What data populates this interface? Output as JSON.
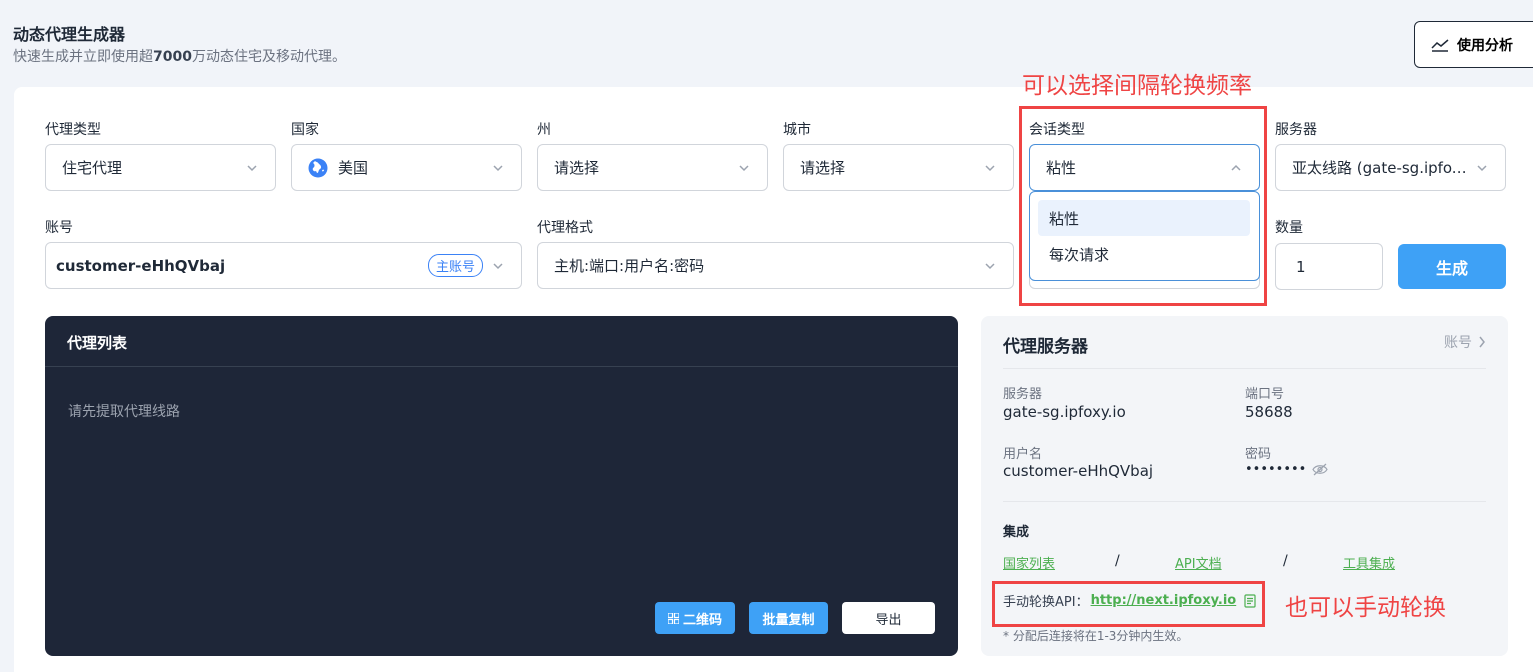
{
  "header": {
    "title": "动态代理生成器",
    "subtitle_prefix": "快速生成并立即使用超",
    "subtitle_bold": "7000",
    "subtitle_suffix": "万动态住宅及移动代理。",
    "analysis_button": "使用分析"
  },
  "annotations": {
    "session_note": "可以选择间隔轮换频率",
    "manual_note": "也可以手动轮换"
  },
  "form": {
    "proxy_type": {
      "label": "代理类型",
      "value": "住宅代理"
    },
    "country": {
      "label": "国家",
      "value": "美国"
    },
    "state": {
      "label": "州",
      "value": "请选择"
    },
    "city": {
      "label": "城市",
      "value": "请选择"
    },
    "session_type": {
      "label": "会话类型",
      "value": "粘性",
      "options": [
        "粘性",
        "每次请求"
      ]
    },
    "server": {
      "label": "服务器",
      "value": "亚太线路 (gate-sg.ipfoxy.io)"
    },
    "account": {
      "label": "账号",
      "value": "customer-eHhQVbaj",
      "badge": "主账号"
    },
    "proxy_format": {
      "label": "代理格式",
      "value": "主机:端口:用户名:密码"
    },
    "quantity": {
      "label": "数量",
      "value": "1"
    },
    "generate_button": "生成"
  },
  "proxy_list": {
    "title": "代理列表",
    "empty_text": "请先提取代理线路",
    "qr_button": "二维码",
    "copy_button": "批量复制",
    "export_button": "导出"
  },
  "server_panel": {
    "title": "代理服务器",
    "account_link": "账号",
    "server_label": "服务器",
    "server_value": "gate-sg.ipfoxy.io",
    "port_label": "端口号",
    "port_value": "58688",
    "user_label": "用户名",
    "user_value": "customer-eHhQVbaj",
    "password_label": "密码",
    "password_value": "••••••••",
    "integration_title": "集成",
    "links": [
      "国家列表",
      "API文档",
      "工具集成"
    ],
    "manual_api_label": "手动轮换API：",
    "manual_api_url": "http://next.ipfoxy.io",
    "note": "* 分配后连接将在1-3分钟内生效。"
  },
  "colors": {
    "accent": "#3ea1f6",
    "annotation": "#ef4444",
    "dark_panel": "#1e2638",
    "link": "#4caf50"
  }
}
